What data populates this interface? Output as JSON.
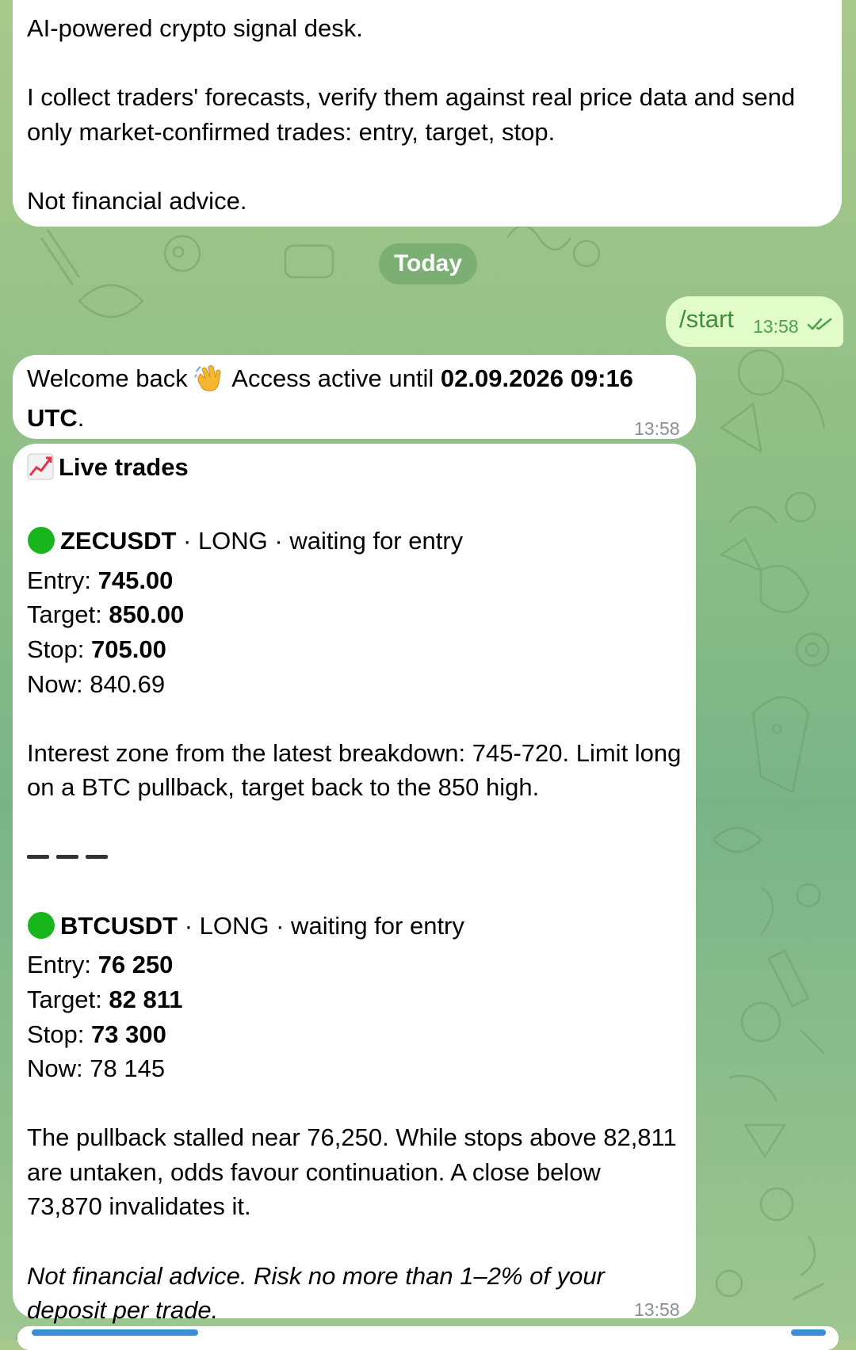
{
  "intro": {
    "line1": "AI-powered crypto signal desk.",
    "line2": "I collect traders' forecasts, verify them against real price data and send only market-confirmed trades: entry, target, stop.",
    "line3": "Not financial advice."
  },
  "date_separator": "Today",
  "outgoing": {
    "text": "/start",
    "time": "13:58",
    "status_icon": "double-check-icon"
  },
  "welcome": {
    "prefix": "Welcome back",
    "emoji": "waving-hand",
    "middle": " Access active until ",
    "until": "02.09.2026 09:16 UTC",
    "suffix": ".",
    "time": "13:58"
  },
  "trades": {
    "emoji": "chart-increasing",
    "title": "Live trades",
    "items": [
      {
        "status_color": "#19b51d",
        "symbol": "ZECUSDT",
        "meta": " · LONG · waiting for entry",
        "entry_label": "Entry: ",
        "entry": "745.00",
        "target_label": "Target: ",
        "target": "850.00",
        "stop_label": "Stop: ",
        "stop": "705.00",
        "now_label": "Now: ",
        "now": "840.69",
        "note": "Interest zone from the latest breakdown: 745-720. Limit long on a BTC pullback, target back to the 850 high."
      },
      {
        "status_color": "#19b51d",
        "symbol": "BTCUSDT",
        "meta": " · LONG · waiting for entry",
        "entry_label": "Entry: ",
        "entry": "76 250",
        "target_label": "Target: ",
        "target": "82 811",
        "stop_label": "Stop: ",
        "stop": "73 300",
        "now_label": "Now: ",
        "now": "78 145",
        "note": "The pullback stalled near 76,250. While stops above 82,811 are untaken, odds favour continuation. A close below 73,870 invalidates it."
      }
    ],
    "disclaimer": "Not financial advice. Risk no more than 1–2% of your deposit per trade.",
    "time": "13:58"
  }
}
